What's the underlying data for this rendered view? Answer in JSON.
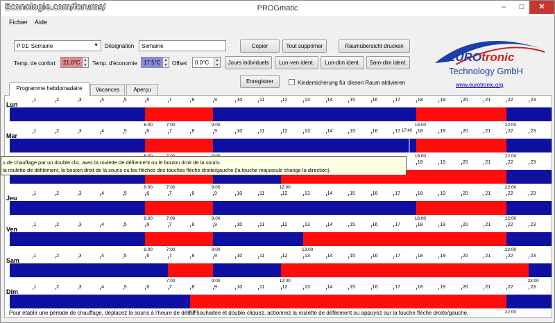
{
  "window": {
    "watermark": "Econologie.com/forums/",
    "title": "PROGmatic",
    "minimize": "–",
    "maximize": "□",
    "close": "✕"
  },
  "menu": {
    "file": "Fichier",
    "help": "Aide"
  },
  "controls": {
    "program_select": "P 01: Semaine",
    "designation_label": "Désignation",
    "designation_value": "Semaine",
    "comfort_label": "Temp. de confort",
    "comfort_value": "21.0°C",
    "eco_label": "Temp. d'économie",
    "eco_value": "17.5°C",
    "offset_label": "Offset",
    "offset_value": "0.0°C",
    "individual_days": "Jours individuels",
    "copy": "Copier",
    "delete_all": "Tout supprimer",
    "print_overview": "Raumübersicht drucken",
    "mon_fri": "Lun-ven ident.",
    "mon_sun": "Lun-dim ident.",
    "sat_sun": "Sam-dim ident.",
    "save": "Enregistrer",
    "child_lock": "Kindersicherung für diesen Raum aktivieren"
  },
  "colors": {
    "comfort": "#ff0d0d",
    "economy": "#1010a0",
    "comfort_field": "#e8888a",
    "eco_field": "#8a8ae0"
  },
  "logo": {
    "brand_a": "EURO",
    "brand_b": "tronic",
    "company": "Technology GmbH",
    "url": "www.eurotronic.org"
  },
  "tabs": [
    "Programme hebdomadaire",
    "Vacances",
    "Aperçu"
  ],
  "hours": [
    "1",
    "2",
    "3",
    "4",
    "5",
    "6",
    "7",
    "8",
    "9",
    "10",
    "11",
    "12",
    "13",
    "14",
    "15",
    "16",
    "17",
    "18",
    "19",
    "20",
    "21",
    "22",
    "23"
  ],
  "days": [
    {
      "name": "Lun",
      "periods": [
        [
          6,
          9
        ],
        [
          18,
          22
        ]
      ],
      "labels": [
        {
          "t": "6:00",
          "h": 6
        },
        {
          "t": "7:00",
          "h": 7
        },
        {
          "t": "9:00",
          "h": 9
        },
        {
          "t": "18:00",
          "h": 18
        },
        {
          "t": "22:00",
          "h": 22
        }
      ]
    },
    {
      "name": "Mar",
      "periods": [
        [
          6,
          9
        ],
        [
          18,
          22
        ]
      ],
      "labels": [
        {
          "t": "6:00",
          "h": 6
        },
        {
          "t": "7:00",
          "h": 7
        },
        {
          "t": "9:00",
          "h": 9
        },
        {
          "t": "18:00",
          "h": 18
        },
        {
          "t": "22:00",
          "h": 22
        }
      ],
      "marker_hour": 17.67,
      "marker_label": "17:40"
    },
    {
      "name": "Mer",
      "periods": [
        [
          6,
          9
        ],
        [
          12,
          22
        ]
      ],
      "labels": [
        {
          "t": "6:00",
          "h": 6
        },
        {
          "t": "7:00",
          "h": 7
        },
        {
          "t": "9:00",
          "h": 9
        },
        {
          "t": "12:00",
          "h": 12
        },
        {
          "t": "22:00",
          "h": 22
        }
      ]
    },
    {
      "name": "Jeu",
      "periods": [
        [
          6,
          9
        ],
        [
          18,
          22
        ]
      ],
      "labels": [
        {
          "t": "6:00",
          "h": 6
        },
        {
          "t": "7:00",
          "h": 7
        },
        {
          "t": "9:00",
          "h": 9
        },
        {
          "t": "18:00",
          "h": 18
        },
        {
          "t": "22:00",
          "h": 22
        }
      ]
    },
    {
      "name": "Ven",
      "periods": [
        [
          6,
          9
        ],
        [
          13,
          22
        ]
      ],
      "labels": [
        {
          "t": "6:00",
          "h": 6
        },
        {
          "t": "7:00",
          "h": 7
        },
        {
          "t": "9:00",
          "h": 9
        },
        {
          "t": "13:00",
          "h": 13
        },
        {
          "t": "22:00",
          "h": 22
        }
      ]
    },
    {
      "name": "Sam",
      "periods": [
        [
          7,
          9
        ],
        [
          12,
          23
        ]
      ],
      "labels": [
        {
          "t": "7:00",
          "h": 7
        },
        {
          "t": "9:00",
          "h": 9
        },
        {
          "t": "12:00",
          "h": 12
        },
        {
          "t": "23:00",
          "h": 23
        }
      ]
    },
    {
      "name": "Dim",
      "periods": [
        [
          8,
          22
        ]
      ],
      "labels": [
        {
          "t": "8:00",
          "h": 8
        },
        {
          "t": "22:00",
          "h": 22
        }
      ]
    }
  ],
  "tooltip": {
    "line1": "s de chauffage par un double clic, avec la roulette de défilement ou le bouton droit de la souris.",
    "line2": "la roulette de défilement, le bouton droit de la souris ou les flèches des touches flèche droite/gauche (la touche majuscule change la direction)."
  },
  "status": "Pour établir une période de chauffage, déplacez la souris à l'heure de début souhaitée et double-cliquez, actionnez la roulette de défilement ou appuyez sur la touche flèche droite/gauche."
}
